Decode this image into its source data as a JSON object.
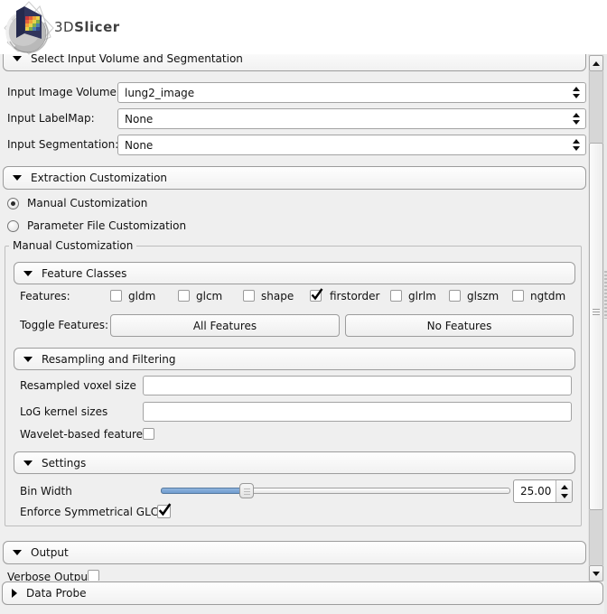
{
  "app": {
    "logo_prefix": "3D",
    "logo_suffix": "Slicer"
  },
  "sections": {
    "select_input": {
      "title": "Select Input Volume and Segmentation"
    },
    "inputs": [
      {
        "label": "Input Image Volume:",
        "value": "lung2_image"
      },
      {
        "label": "Input LabelMap:",
        "value": "None"
      },
      {
        "label": "Input Segmentation:",
        "value": "None"
      }
    ],
    "extraction": {
      "title": "Extraction Customization"
    },
    "radios": [
      {
        "label": "Manual Customization",
        "selected": true
      },
      {
        "label": "Parameter File Customization",
        "selected": false
      }
    ],
    "manual_group": {
      "title": "Manual Customization"
    },
    "feature_classes": {
      "title": "Feature Classes",
      "features_label": "Features:",
      "checkboxes": [
        {
          "label": "gldm",
          "checked": false
        },
        {
          "label": "glcm",
          "checked": false
        },
        {
          "label": "shape",
          "checked": false
        },
        {
          "label": "firstorder",
          "checked": true
        },
        {
          "label": "glrlm",
          "checked": false
        },
        {
          "label": "glszm",
          "checked": false
        },
        {
          "label": "ngtdm",
          "checked": false
        }
      ],
      "toggle_label": "Toggle Features:",
      "all_button": "All Features",
      "no_button": "No Features"
    },
    "resampling": {
      "title": "Resampling and Filtering",
      "voxel_label": "Resampled voxel size",
      "voxel_value": "",
      "log_label": "LoG kernel sizes",
      "log_value": "",
      "wavelet_label": "Wavelet-based features",
      "wavelet_checked": false
    },
    "settings": {
      "title": "Settings",
      "bin_width_label": "Bin Width",
      "bin_width_value": "25.00",
      "glcm_label": "Enforce Symmetrical GLCM",
      "glcm_checked": true
    },
    "output": {
      "title": "Output",
      "verbose_label": "Verbose Output"
    },
    "data_probe": {
      "title": "Data Probe"
    }
  },
  "colors": {
    "panel_bg": "#efefef",
    "slider_fill": "#6f9cce",
    "widget_border": "#9c9c9c"
  }
}
